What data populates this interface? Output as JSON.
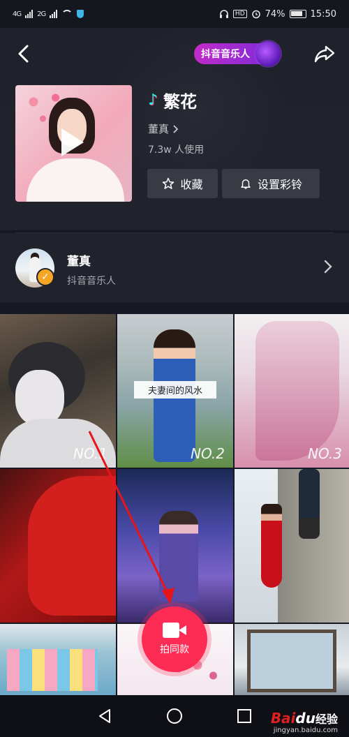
{
  "status_bar": {
    "net1": "4G",
    "net2": "2G",
    "battery_pct": "74%",
    "battery_level": 0.74,
    "time": "15:50"
  },
  "header": {
    "badge_label": "抖音音乐人",
    "song_title": "繁花",
    "artist_link": "董真",
    "usage": "7.3w 人使用",
    "favorite_label": "收藏",
    "ringtone_label": "设置彩铃"
  },
  "artist": {
    "name": "董真",
    "tag": "抖音音乐人"
  },
  "grid": {
    "tiles": [
      {
        "label": "NO.1"
      },
      {
        "label": "NO.2",
        "caption": "夫妻间的风水"
      },
      {
        "label": "NO.3"
      }
    ]
  },
  "record": {
    "label": "拍同款"
  },
  "watermark": {
    "logo_prefix": "Bai",
    "logo_mid": "du",
    "logo_suffix": "经验",
    "url": "jingyan.baidu.com"
  },
  "colors": {
    "background": "#161823",
    "accent": "#fe2c55",
    "cyan": "#25f4ee",
    "badge_gradient_start": "#c12bc8",
    "badge_gradient_end": "#7a2bd8",
    "verified": "#f5a623"
  },
  "icons": [
    "back-icon",
    "share-icon",
    "star-icon",
    "bell-icon",
    "play-icon",
    "music-note-icon",
    "chevron-right-icon",
    "camera-icon",
    "nav-back-icon",
    "nav-home-icon",
    "nav-recents-icon"
  ]
}
